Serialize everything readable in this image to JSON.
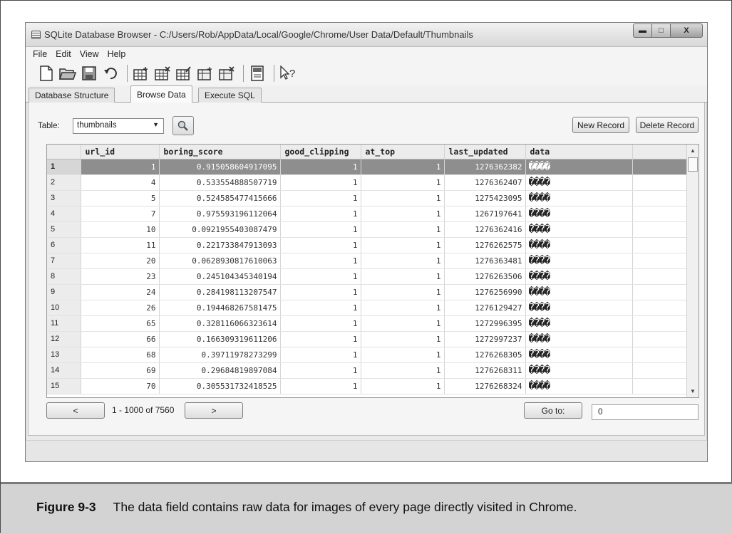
{
  "window": {
    "title": "SQLite Database Browser - C:/Users/Rob/AppData/Local/Google/Chrome/User Data/Default/Thumbnails",
    "minimize_glyph": "▬",
    "maximize_glyph": "□",
    "close_glyph": "X"
  },
  "menu": [
    "File",
    "Edit",
    "View",
    "Help"
  ],
  "toolbar_icons": [
    "new-file-icon",
    "open-folder-icon",
    "save-icon",
    "undo-icon",
    "create-table-icon",
    "delete-table-icon",
    "modify-table-icon",
    "create-index-icon",
    "delete-index-icon",
    "log-icon",
    "whats-this-icon"
  ],
  "tabs": [
    "Database Structure",
    "Browse Data",
    "Execute SQL"
  ],
  "active_tab": "Browse Data",
  "browse": {
    "table_label": "Table:",
    "table_value": "thumbnails",
    "new_record": "New Record",
    "delete_record": "Delete Record",
    "prev_label": "<",
    "next_label": ">",
    "range_text": "1 - 1000 of 7560",
    "goto_label": "Go to:",
    "goto_value": "0"
  },
  "columns": [
    "url_id",
    "boring_score",
    "good_clipping",
    "at_top",
    "last_updated",
    "data"
  ],
  "rows": [
    {
      "n": "1",
      "url_id": "1",
      "boring_score": "0.915058604917095",
      "good_clipping": "1",
      "at_top": "1",
      "last_updated": "1276362382",
      "data": "����"
    },
    {
      "n": "2",
      "url_id": "4",
      "boring_score": "0.533554888507719",
      "good_clipping": "1",
      "at_top": "1",
      "last_updated": "1276362407",
      "data": "����"
    },
    {
      "n": "3",
      "url_id": "5",
      "boring_score": "0.524585477415666",
      "good_clipping": "1",
      "at_top": "1",
      "last_updated": "1275423095",
      "data": "����"
    },
    {
      "n": "4",
      "url_id": "7",
      "boring_score": "0.975593196112064",
      "good_clipping": "1",
      "at_top": "1",
      "last_updated": "1267197641",
      "data": "����"
    },
    {
      "n": "5",
      "url_id": "10",
      "boring_score": "0.0921955403087479",
      "good_clipping": "1",
      "at_top": "1",
      "last_updated": "1276362416",
      "data": "����"
    },
    {
      "n": "6",
      "url_id": "11",
      "boring_score": "0.221733847913093",
      "good_clipping": "1",
      "at_top": "1",
      "last_updated": "1276262575",
      "data": "����"
    },
    {
      "n": "7",
      "url_id": "20",
      "boring_score": "0.0628930817610063",
      "good_clipping": "1",
      "at_top": "1",
      "last_updated": "1276363481",
      "data": "����"
    },
    {
      "n": "8",
      "url_id": "23",
      "boring_score": "0.245104345340194",
      "good_clipping": "1",
      "at_top": "1",
      "last_updated": "1276263506",
      "data": "����"
    },
    {
      "n": "9",
      "url_id": "24",
      "boring_score": "0.284198113207547",
      "good_clipping": "1",
      "at_top": "1",
      "last_updated": "1276256990",
      "data": "����"
    },
    {
      "n": "10",
      "url_id": "26",
      "boring_score": "0.194468267581475",
      "good_clipping": "1",
      "at_top": "1",
      "last_updated": "1276129427",
      "data": "����"
    },
    {
      "n": "11",
      "url_id": "65",
      "boring_score": "0.328116066323614",
      "good_clipping": "1",
      "at_top": "1",
      "last_updated": "1272996395",
      "data": "����"
    },
    {
      "n": "12",
      "url_id": "66",
      "boring_score": "0.166309319611206",
      "good_clipping": "1",
      "at_top": "1",
      "last_updated": "1272997237",
      "data": "����"
    },
    {
      "n": "13",
      "url_id": "68",
      "boring_score": "0.39711978273299",
      "good_clipping": "1",
      "at_top": "1",
      "last_updated": "1276268305",
      "data": "����"
    },
    {
      "n": "14",
      "url_id": "69",
      "boring_score": "0.29684819897084",
      "good_clipping": "1",
      "at_top": "1",
      "last_updated": "1276268311",
      "data": "����"
    },
    {
      "n": "15",
      "url_id": "70",
      "boring_score": "0.305531732418525",
      "good_clipping": "1",
      "at_top": "1",
      "last_updated": "1276268324",
      "data": "����"
    }
  ],
  "selected_row": "1",
  "caption": {
    "label": "Figure 9-3",
    "text": "The data field contains raw data for images of every page directly visited in Chrome."
  },
  "colors": {
    "selected_row": "#8e8e8e",
    "caption_bg": "#d3d3d3"
  }
}
